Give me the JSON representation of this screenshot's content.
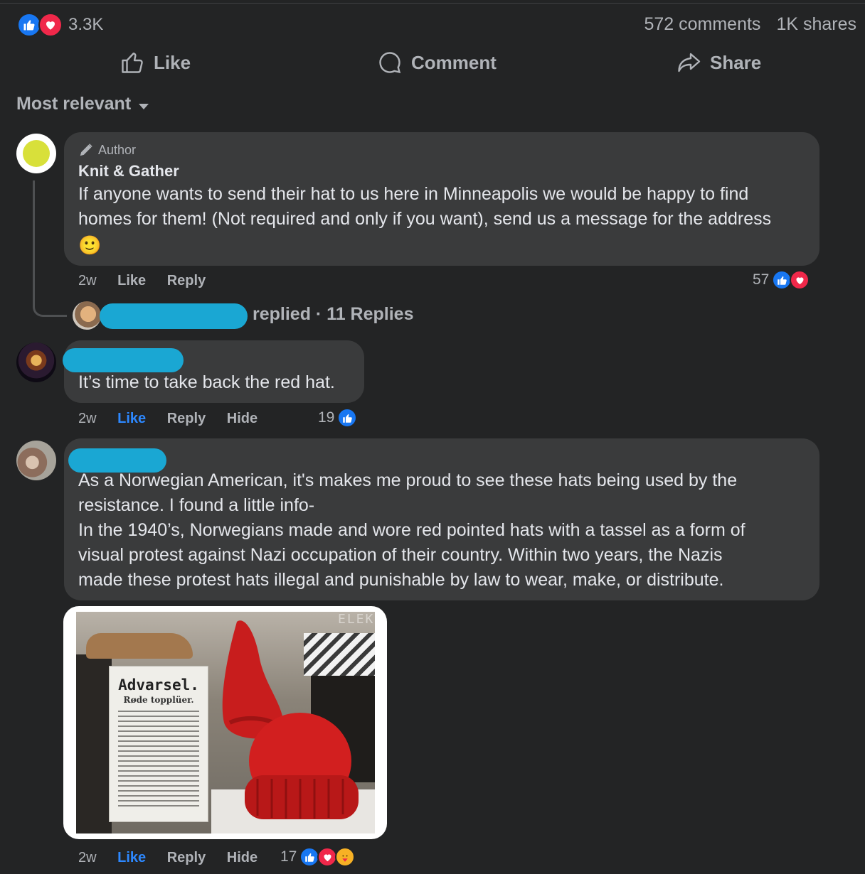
{
  "post_stats": {
    "reaction_count": "3.3K",
    "comments": "572 comments",
    "shares": "1K shares"
  },
  "actions": {
    "like": "Like",
    "comment": "Comment",
    "share": "Share"
  },
  "sort": {
    "label": "Most relevant"
  },
  "comments": [
    {
      "badge": "Author",
      "author": "Knit & Gather",
      "text_line1": "If anyone wants to send their hat to us here in Minneapolis we would be happy to find",
      "text_line2": "homes for them! (Not required and only if you want), send us a message for the address",
      "emoji": "🙂",
      "time": "2w",
      "like": "Like",
      "reply": "Reply",
      "reaction_count": "57",
      "replies_label": "replied · 11 Replies"
    },
    {
      "text": "It’s time to take back the red hat.",
      "time": "2w",
      "like": "Like",
      "reply": "Reply",
      "hide": "Hide",
      "reaction_count": "19"
    },
    {
      "lines": [
        "As a Norwegian American, it's makes me proud to see these hats being used by the",
        "resistance. I found a little info-",
        "In the 1940’s, Norwegians made and wore red pointed hats with a tassel as a form of",
        "visual protest against Nazi occupation of their country. Within two years, the Nazis",
        "made these protest hats illegal and punishable by law to wear, make, or distribute."
      ],
      "time": "2w",
      "like": "Like",
      "reply": "Reply",
      "hide": "Hide",
      "reaction_count": "17",
      "photo": {
        "poster_title": "Advarsel.",
        "poster_subtitle": "Røde topplüer.",
        "sign_text": "ELEK"
      }
    }
  ],
  "colors": {
    "background": "#232425",
    "bubble": "#3a3b3c",
    "accent_blue": "#2d88ff",
    "like_blue": "#1877f2",
    "love_red": "#f0284a",
    "redaction": "#1aa7d3"
  },
  "icons": [
    "like-reaction-icon",
    "love-reaction-icon",
    "care-reaction-icon",
    "thumbs-up-icon",
    "comment-icon",
    "share-icon",
    "caret-down-icon",
    "pencil-icon"
  ]
}
